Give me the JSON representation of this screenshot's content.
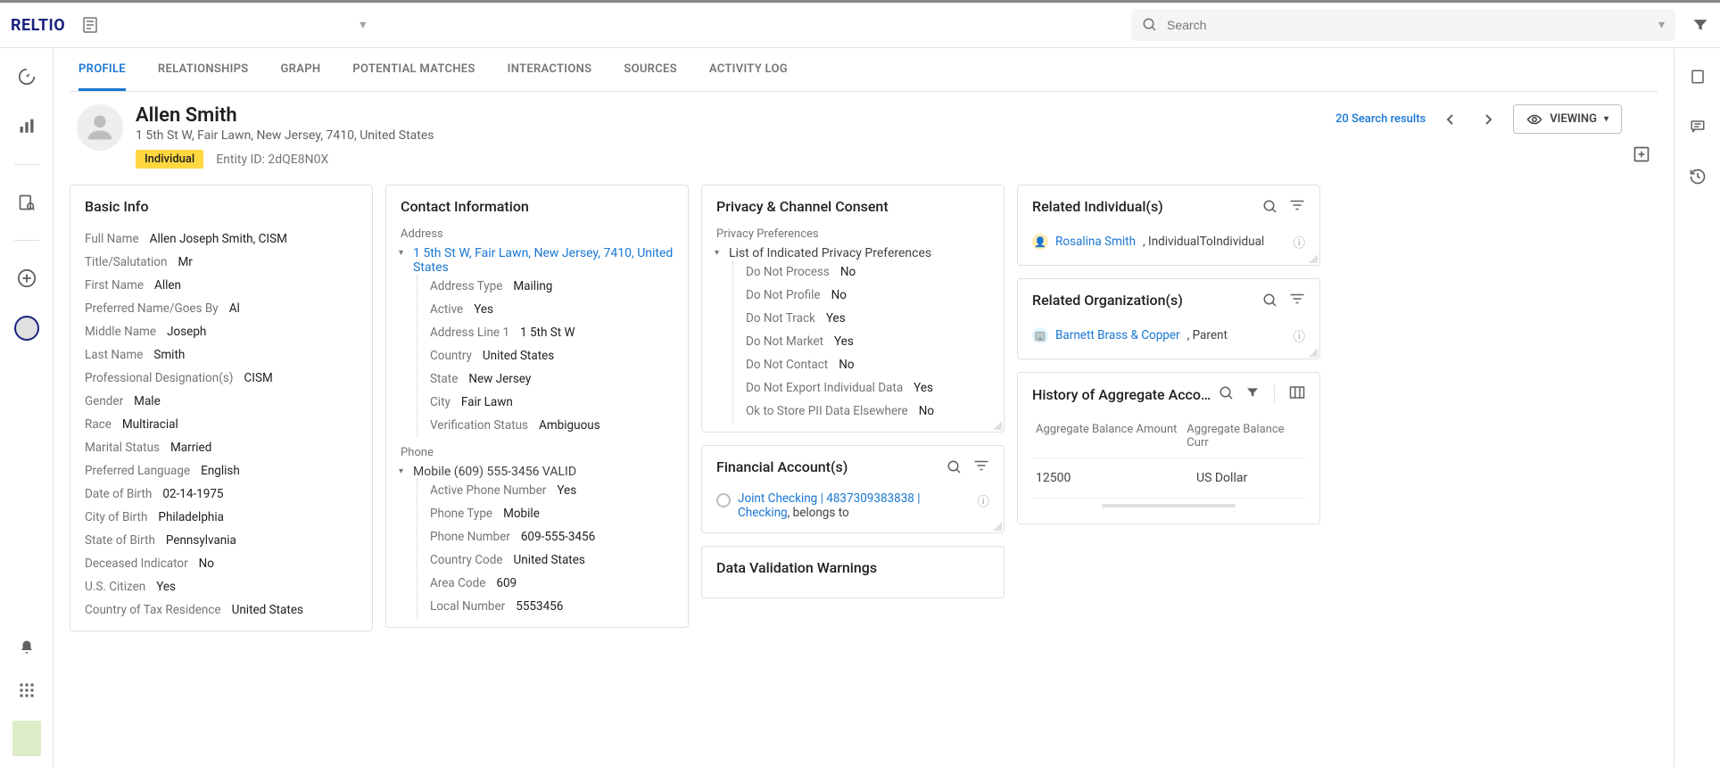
{
  "topbar": {
    "search_placeholder": "Search"
  },
  "tabs": [
    "PROFILE",
    "RELATIONSHIPS",
    "GRAPH",
    "POTENTIAL MATCHES",
    "INTERACTIONS",
    "SOURCES",
    "ACTIVITY LOG"
  ],
  "header": {
    "name": "Allen Smith",
    "address_line": "1 5th St W, Fair Lawn, New Jersey, 7410, United States",
    "tag": "Individual",
    "entity_id": "Entity ID: 2dQE8N0X",
    "search_results": "20 Search results",
    "viewing": "VIEWING"
  },
  "basic_info": {
    "title": "Basic Info",
    "full_name_k": "Full Name",
    "full_name_v": "Allen Joseph Smith, CISM",
    "salutation_k": "Title/Salutation",
    "salutation_v": "Mr",
    "first_name_k": "First Name",
    "first_name_v": "Allen",
    "pref_name_k": "Preferred Name/Goes By",
    "pref_name_v": "Al",
    "middle_k": "Middle Name",
    "middle_v": "Joseph",
    "last_k": "Last Name",
    "last_v": "Smith",
    "prof_k": "Professional Designation(s)",
    "prof_v": "CISM",
    "gender_k": "Gender",
    "gender_v": "Male",
    "race_k": "Race",
    "race_v": "Multiracial",
    "marital_k": "Marital Status",
    "marital_v": "Married",
    "lang_k": "Preferred Language",
    "lang_v": "English",
    "dob_k": "Date of Birth",
    "dob_v": "02-14-1975",
    "cob_k": "City of Birth",
    "cob_v": "Philadelphia",
    "sob_k": "State of Birth",
    "sob_v": "Pennsylvania",
    "dec_k": "Deceased Indicator",
    "dec_v": "No",
    "usc_k": "U.S. Citizen",
    "usc_v": "Yes",
    "ctr_k": "Country of Tax Residence",
    "ctr_v": "United States"
  },
  "contact": {
    "title": "Contact Information",
    "addr_label": "Address",
    "addr_link": "1 5th St W, Fair Lawn, New Jersey, 7410, United States",
    "a_type_k": "Address Type",
    "a_type_v": "Mailing",
    "a_active_k": "Active",
    "a_active_v": "Yes",
    "a_line1_k": "Address Line 1",
    "a_line1_v": "1 5th St W",
    "a_country_k": "Country",
    "a_country_v": "United States",
    "a_state_k": "State",
    "a_state_v": "New Jersey",
    "a_city_k": "City",
    "a_city_v": "Fair Lawn",
    "a_ver_k": "Verification Status",
    "a_ver_v": "Ambiguous",
    "phone_label": "Phone",
    "phone_link": "Mobile (609) 555-3456 VALID",
    "p_active_k": "Active Phone Number",
    "p_active_v": "Yes",
    "p_type_k": "Phone Type",
    "p_type_v": "Mobile",
    "p_num_k": "Phone Number",
    "p_num_v": "609-555-3456",
    "p_cc_k": "Country Code",
    "p_cc_v": "United States",
    "p_ac_k": "Area Code",
    "p_ac_v": "609",
    "p_ln_k": "Local Number",
    "p_ln_v": "5553456"
  },
  "privacy": {
    "title": "Privacy & Channel Consent",
    "pref_label": "Privacy Preferences",
    "list_label": "List of Indicated Privacy Preferences",
    "dnp_k": "Do Not Process",
    "dnp_v": "No",
    "dnpr_k": "Do Not Profile",
    "dnpr_v": "No",
    "dnt_k": "Do Not Track",
    "dnt_v": "Yes",
    "dnm_k": "Do Not Market",
    "dnm_v": "Yes",
    "dnc_k": "Do Not Contact",
    "dnc_v": "No",
    "dne_k": "Do Not Export Individual Data",
    "dne_v": "Yes",
    "ok_k": "Ok to Store PII Data Elsewhere",
    "ok_v": "No"
  },
  "financial": {
    "title": "Financial Account(s)",
    "account_link": "Joint Checking | 4837309383838 | Checking",
    "rel": ", belongs to"
  },
  "dvw": {
    "title": "Data Validation Warnings"
  },
  "rel_ind": {
    "title": "Related Individual(s)",
    "name": "Rosalina Smith",
    "rel": ", IndividualToIndividual"
  },
  "rel_org": {
    "title": "Related Organization(s)",
    "name": "Barnett Brass & Copper",
    "rel": ", Parent"
  },
  "history": {
    "title": "History of Aggregate Acco…",
    "col1": "Aggregate Balance Amount",
    "col2": "Aggregate Balance Curr",
    "v1": "12500",
    "v2": "US Dollar"
  }
}
